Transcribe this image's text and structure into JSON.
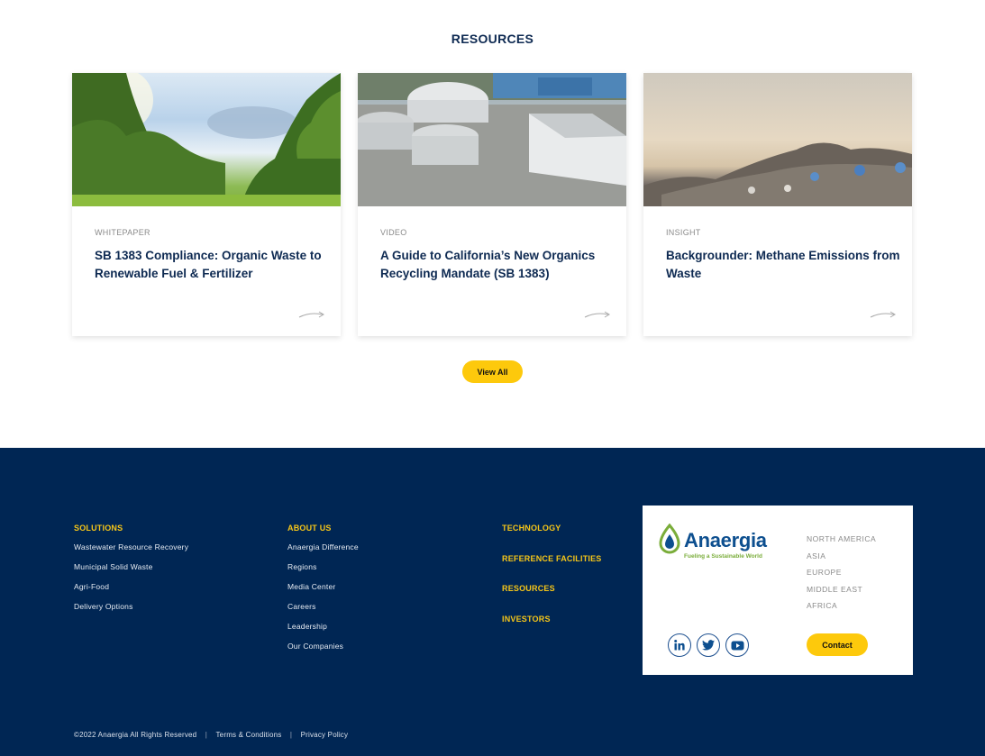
{
  "resources": {
    "title": "RESOURCES",
    "cards": [
      {
        "type": "WHITEPAPER",
        "title": "SB 1383 Compliance: Organic Waste to Renewable Fuel & Fertilizer",
        "image": "park-trees-photo"
      },
      {
        "type": "VIDEO",
        "title": "A Guide to California’s New Organics Recycling Mandate (SB 1383)",
        "image": "biogas-plant-aerial-photo"
      },
      {
        "type": "INSIGHT",
        "title": "Backgrounder: Methane Emissions from Waste",
        "image": "landfill-waste-pile-photo"
      }
    ],
    "view_all_label": "View All"
  },
  "footer": {
    "solutions": {
      "heading": "SOLUTIONS",
      "links": [
        "Wastewater Resource Recovery",
        "Municipal Solid Waste",
        "Agri-Food",
        "Delivery Options"
      ]
    },
    "about": {
      "heading": "ABOUT US",
      "links": [
        "Anaergia Difference",
        "Regions",
        "Media Center",
        "Careers",
        "Leadership",
        "Our Companies"
      ]
    },
    "standalone": [
      "TECHNOLOGY",
      "REFERENCE FACILITIES",
      "RESOURCES",
      "INVESTORS"
    ],
    "brand": {
      "name": "Anaergia",
      "tagline": "Fueling a Sustainable World",
      "regions": [
        "NORTH AMERICA",
        "ASIA",
        "EUROPE",
        "MIDDLE EAST",
        "AFRICA"
      ],
      "socials": [
        "linkedin-icon",
        "twitter-icon",
        "youtube-icon"
      ],
      "contact_label": "Contact"
    },
    "legal": {
      "copyright": "©2022 Anaergia  All Rights Reserved",
      "separator": "|",
      "terms": "Terms & Conditions",
      "privacy": "Privacy Policy"
    }
  },
  "colors": {
    "navy": "#002654",
    "title_navy": "#0e2a52",
    "accent_yellow": "#fdc90c",
    "footer_heading_yellow": "#f5c518",
    "logo_blue": "#0d4f8f",
    "logo_green": "#7aad3a"
  }
}
